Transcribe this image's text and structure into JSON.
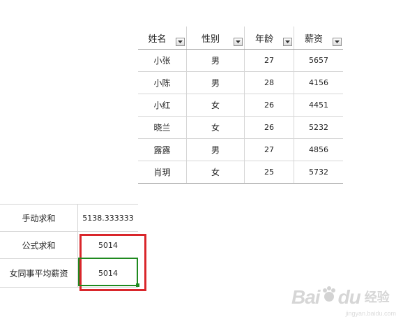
{
  "employee_table": {
    "headers": [
      {
        "label": "姓名"
      },
      {
        "label": "性别"
      },
      {
        "label": "年龄"
      },
      {
        "label": "薪资"
      }
    ],
    "rows": [
      {
        "name": "小张",
        "gender": "男",
        "age": "27",
        "salary": "5657"
      },
      {
        "name": "小陈",
        "gender": "男",
        "age": "28",
        "salary": "4156"
      },
      {
        "name": "小红",
        "gender": "女",
        "age": "26",
        "salary": "4451"
      },
      {
        "name": "晓兰",
        "gender": "女",
        "age": "26",
        "salary": "5232"
      },
      {
        "name": "露露",
        "gender": "男",
        "age": "27",
        "salary": "4856"
      },
      {
        "name": "肖玥",
        "gender": "女",
        "age": "25",
        "salary": "5732"
      }
    ]
  },
  "summary_table": {
    "rows": [
      {
        "label": "手动求和",
        "value": "5138.333333"
      },
      {
        "label": "公式求和",
        "value": "5014"
      },
      {
        "label": "女同事平均薪资",
        "value": "5014"
      }
    ]
  },
  "highlight": {
    "red_box_color": "#d9262b",
    "selection_color": "#1f8a1f"
  },
  "watermark": {
    "brand": "Bai",
    "brand_suffix": "du",
    "text": "经验",
    "sub": "jingyan.baidu.com"
  },
  "icons": {
    "filter": "dropdown-arrow-icon",
    "paw": "baidu-paw-icon"
  }
}
